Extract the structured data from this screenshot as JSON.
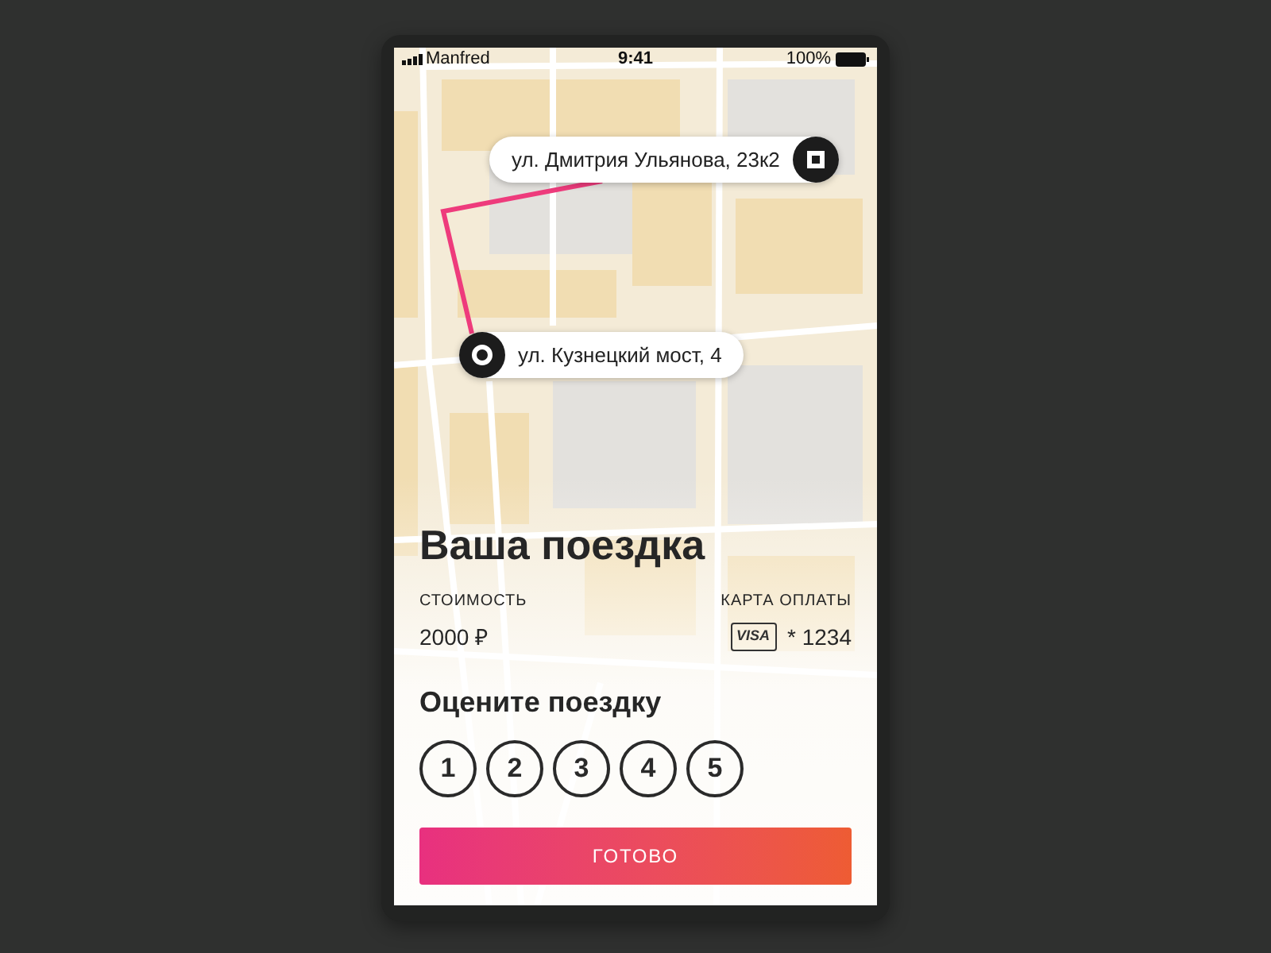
{
  "status_bar": {
    "carrier": "Manfred",
    "time": "9:41",
    "battery": "100%"
  },
  "map": {
    "pins": [
      {
        "kind": "finish",
        "address": "ул. Дмитрия Ульянова, 23к2"
      },
      {
        "kind": "start",
        "address": "ул. Кузнецкий мост, 4"
      }
    ]
  },
  "trip": {
    "title": "Ваша поездка",
    "cost": {
      "label": "СТОИМОСТЬ",
      "value": "2000 ₽"
    },
    "payment": {
      "label": "КАРТА ОПЛАТЫ",
      "card_brand": "VISA",
      "card_number": "* 1234"
    }
  },
  "rating": {
    "title": "Оцените поездку",
    "options": [
      {
        "label": "1",
        "selected": false
      },
      {
        "label": "2",
        "selected": false
      },
      {
        "label": "3",
        "selected": false
      },
      {
        "label": "4",
        "selected": false
      },
      {
        "label": "5",
        "selected": false
      }
    ]
  },
  "done_button": {
    "label": "ГОТОВО"
  }
}
